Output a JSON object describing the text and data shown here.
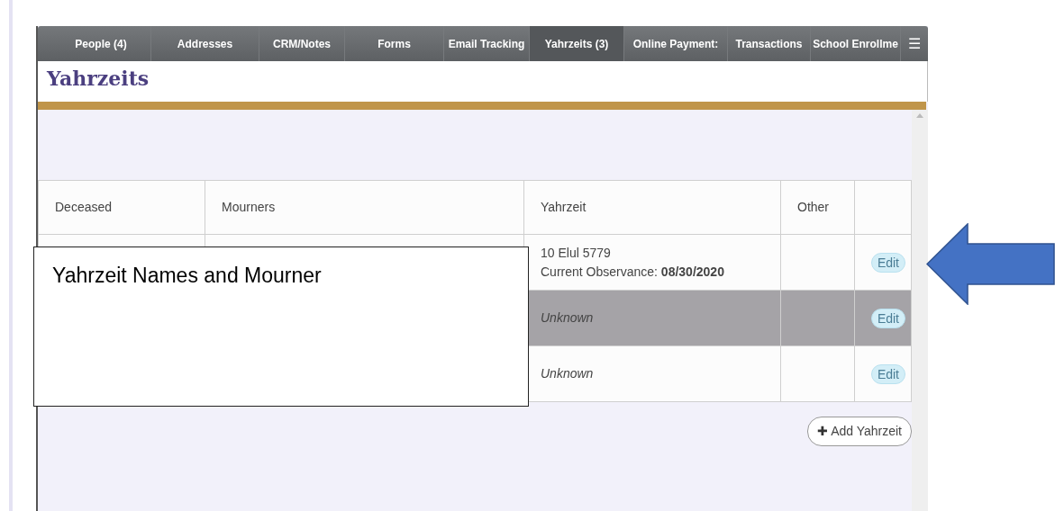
{
  "tabs": [
    {
      "label": "People (4)",
      "selected": false
    },
    {
      "label": "Addresses",
      "selected": false
    },
    {
      "label": "CRM/Notes",
      "selected": false
    },
    {
      "label": "Forms",
      "selected": false
    },
    {
      "label": "Email Tracking",
      "selected": false
    },
    {
      "label": "Yahrzeits (3)",
      "selected": true
    },
    {
      "label": "Online Payment:",
      "selected": false
    },
    {
      "label": "Transactions",
      "selected": false
    },
    {
      "label": "School Enrollme",
      "selected": false
    }
  ],
  "menu_icon": "☰",
  "page_title": "Yahrzeits",
  "table": {
    "columns": [
      "Deceased",
      "Mourners",
      "Yahrzeit",
      "Other"
    ],
    "rows": [
      {
        "yahrzeit": "10 Elul 5779",
        "observance_label": "Current Observance:",
        "observance_date": "08/30/2020",
        "highlighted": false,
        "action": "Edit"
      },
      {
        "yahrzeit": "Unknown",
        "highlighted": true,
        "action": "Edit"
      },
      {
        "yahrzeit": "Unknown",
        "highlighted": false,
        "action": "Edit"
      }
    ]
  },
  "add_button": {
    "icon": "✚",
    "label": "Add Yahrzeit"
  },
  "callout": {
    "text": "Yahrzeit Names and Mourner"
  }
}
